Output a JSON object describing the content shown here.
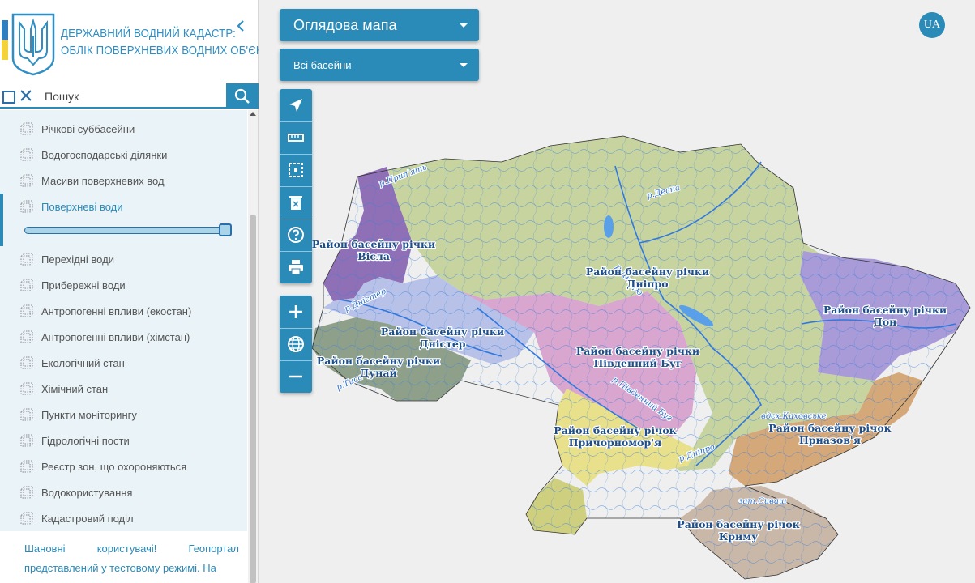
{
  "header": {
    "title_line1": "ДЕРЖАВНИЙ ВОДНИЙ КАДАСТР:",
    "title_line2": "ОБЛІК ПОВЕРХНЕВИХ ВОДНИХ ОБ'ЄКТІВ"
  },
  "search": {
    "placeholder": "Пошук"
  },
  "layers": [
    {
      "label": "Річкові суббасейни"
    },
    {
      "label": "Водогосподарські ділянки"
    },
    {
      "label": "Масиви поверхневих вод"
    },
    {
      "label": "Поверхневі води",
      "active": true
    },
    {
      "label": "Перехідні води"
    },
    {
      "label": "Прибережні води"
    },
    {
      "label": "Антропогенні впливи (екостан)"
    },
    {
      "label": "Антропогенні впливи (хімстан)"
    },
    {
      "label": "Екологічний стан"
    },
    {
      "label": "Хімічний стан"
    },
    {
      "label": "Пункти моніторингу"
    },
    {
      "label": "Гідрологічні пости"
    },
    {
      "label": "Реєстр зон, що охороняються"
    },
    {
      "label": "Водокористування"
    },
    {
      "label": "Кадастровий поділ"
    }
  ],
  "opacity_slider": {
    "value": 1.0
  },
  "notice": "Шановні користувачі! Геопортал представлений у тестовому режимі. На",
  "map_controls": {
    "map_select": "Оглядова мапа",
    "basin_select": "Всі басейни",
    "language": "UA"
  },
  "tools": [
    {
      "icon": "navigate-icon"
    },
    {
      "icon": "ruler-icon"
    },
    {
      "icon": "area-select-icon"
    },
    {
      "icon": "clear-icon"
    },
    {
      "icon": "help-icon"
    },
    {
      "icon": "print-icon"
    }
  ],
  "zoom": [
    {
      "icon": "zoom-in-icon"
    },
    {
      "icon": "globe-icon"
    },
    {
      "icon": "zoom-out-icon"
    }
  ],
  "basins": {
    "vistula": {
      "line1": "Район басейну річки",
      "line2": "Вісла",
      "color": "#8f6fb5"
    },
    "dnieper": {
      "line1": "Район басейну річки",
      "line2": "Дніпро",
      "color": "#c7d4a0"
    },
    "don": {
      "line1": "Район басейну річки",
      "line2": "Дон",
      "color": "#a99ad8"
    },
    "dniester": {
      "line1": "Район басейну річки",
      "line2": "Дністер",
      "color": "#b8c2e8"
    },
    "danube": {
      "line1": "Район басейну річки",
      "line2": "Дунай",
      "color": "#8fa08a"
    },
    "southern_bug": {
      "line1": "Район басейну річки",
      "line2": "Південний Буг",
      "color": "#d9a6cf"
    },
    "black_sea": {
      "line1": "Район басейну річок",
      "line2": "Причорномор'я",
      "color": "#e8e08a"
    },
    "azov": {
      "line1": "Район басейну річок",
      "line2": "Приазов'я",
      "color": "#d5a87a"
    },
    "crimea": {
      "line1": "Район басейну річок",
      "line2": "Криму",
      "color": "#c9b8a8"
    }
  },
  "rivers": {
    "prypiat": "р.Прип'ять",
    "desna": "р.Десна",
    "dnieper_upper": "р.Дніпро",
    "dnieper_lower": "р.Дніпро",
    "dnister": "р.Дністер",
    "tysa": "р.Тиса",
    "southern_bug": "р.Південний Буг",
    "kakhovka": "вдсх.Каховське",
    "syvash": "зат.Сиваш"
  }
}
